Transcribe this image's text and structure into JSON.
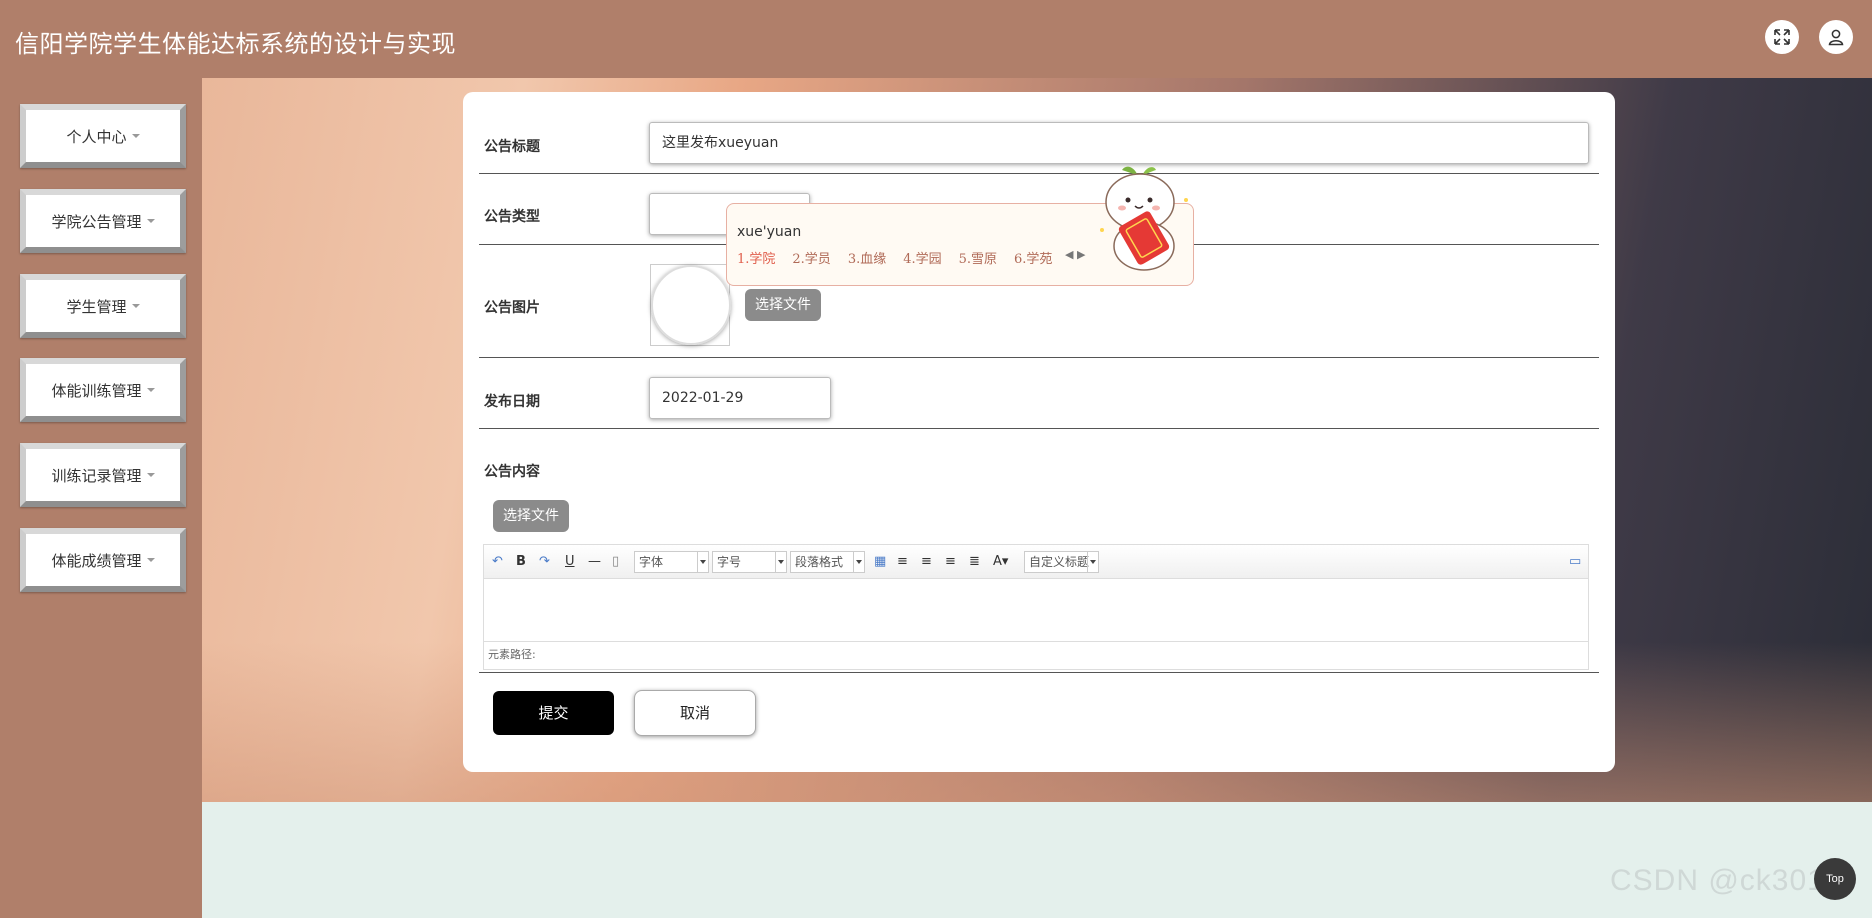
{
  "header": {
    "title": "信阳学院学生体能达标系统的设计与实现",
    "fullscreen_icon": "expand-icon",
    "user_icon": "user-icon"
  },
  "sidebar": {
    "items": [
      {
        "label": "个人中心"
      },
      {
        "label": "学院公告管理"
      },
      {
        "label": "学生管理"
      },
      {
        "label": "体能训练管理"
      },
      {
        "label": "训练记录管理"
      },
      {
        "label": "体能成绩管理"
      }
    ]
  },
  "form": {
    "title_label": "公告标题",
    "title_value": "这里发布xueyuan",
    "type_label": "公告类型",
    "type_value": "",
    "image_label": "公告图片",
    "image_button": "选择文件",
    "date_label": "发布日期",
    "date_value": "2022-01-29",
    "content_label": "公告内容",
    "content_button": "选择文件",
    "submit_label": "提交",
    "cancel_label": "取消"
  },
  "editor": {
    "font_family": "字体",
    "font_size": "字号",
    "paragraph": "段落格式",
    "custom_title": "自定义标题",
    "path_label": "元素路径:"
  },
  "ime": {
    "composition": "xue'yuan",
    "candidates": [
      "1.学院",
      "2.学员",
      "3.血缘",
      "4.学园",
      "5.雪原",
      "6.学苑"
    ]
  },
  "watermark": "CSDN @ck3017",
  "top_button": "Top",
  "colors": {
    "header": "#b07f6a",
    "sidebar": "#b07f6a",
    "submit": "#000000",
    "gray_button": "#8b8b8b"
  }
}
